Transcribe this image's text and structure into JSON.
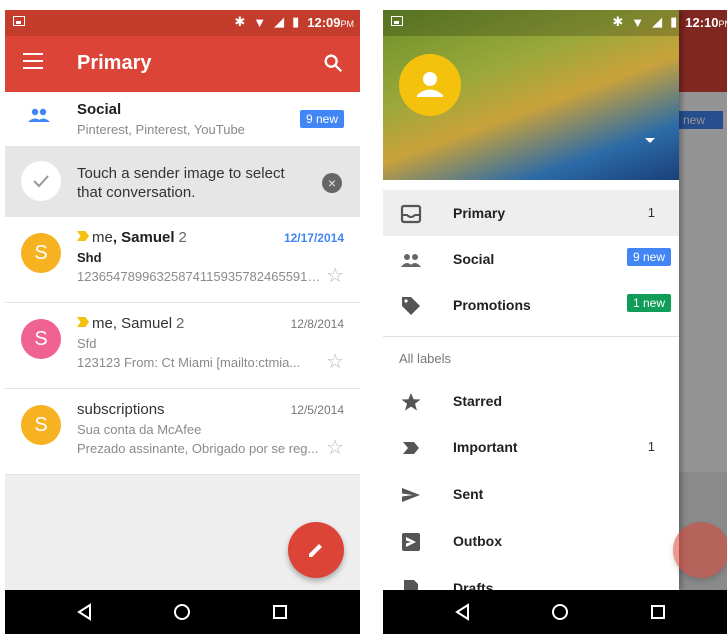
{
  "left": {
    "status": {
      "time": "12:09",
      "ampm": "PM"
    },
    "appbar": {
      "title": "Primary"
    },
    "social_row": {
      "title": "Social",
      "subtitle": "Pinterest, Pinterest, YouTube",
      "badge": "9 new"
    },
    "tip": {
      "text": "Touch a sender image to select that conversation.",
      "close": "×"
    },
    "messages": [
      {
        "avatar": "S",
        "avatar_color": "#f6b221",
        "sender_pre": "me",
        "sender_bold": ", Samuel",
        "count": "2",
        "date": "12/17/2014",
        "subject": "Shd",
        "snippet": "1236547899632587411593578246559123...",
        "important": true,
        "unread": true
      },
      {
        "avatar": "S",
        "avatar_color": "#f06292",
        "sender_pre": "me, Samuel",
        "sender_bold": "",
        "count": "2",
        "date": "12/8/2014",
        "subject": "Sfd",
        "snippet": "123123 From: Ct Miami [mailto:ctmia...",
        "important": true,
        "unread": false
      },
      {
        "avatar": "S",
        "avatar_color": "#f6b221",
        "sender_pre": "subscriptions",
        "sender_bold": "",
        "count": "",
        "date": "12/5/2014",
        "subject": "Sua conta da McAfee",
        "snippet": "Prezado assinante, Obrigado por se reg...",
        "important": false,
        "unread": false
      }
    ]
  },
  "right": {
    "status": {
      "time": "12:10",
      "ampm": "PM"
    },
    "behind_badge": "new",
    "drawer": {
      "items": [
        {
          "label": "Primary",
          "count": "1",
          "badge": "",
          "icon": "inbox-icon"
        },
        {
          "label": "Social",
          "count": "",
          "badge": "9 new",
          "badge_color": "#4285f4",
          "icon": "people-icon"
        },
        {
          "label": "Promotions",
          "count": "",
          "badge": "1 new",
          "badge_color": "#0f9d58",
          "icon": "tag-icon"
        }
      ],
      "section": "All labels",
      "labels": [
        {
          "label": "Starred",
          "count": "",
          "icon": "star-icon"
        },
        {
          "label": "Important",
          "count": "1",
          "icon": "important-icon"
        },
        {
          "label": "Sent",
          "count": "",
          "icon": "send-icon"
        },
        {
          "label": "Outbox",
          "count": "",
          "icon": "outbox-icon"
        },
        {
          "label": "Drafts",
          "count": "",
          "icon": "draft-icon"
        }
      ]
    }
  },
  "colors": {
    "primary_red": "#db4437",
    "status_red": "#c43c2c",
    "badge_blue": "#4285f4",
    "badge_green": "#0f9d58"
  }
}
